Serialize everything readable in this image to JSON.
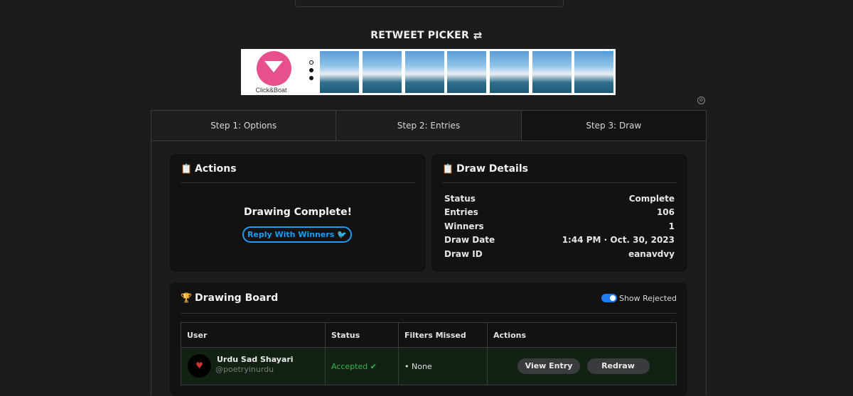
{
  "header": {
    "title": "RETWEET PICKER",
    "title_icon": "retweet-icon"
  },
  "ad": {
    "brand": "Click&Boat",
    "logo_icon": "paper-boat-icon",
    "choice_mark": "▷✕"
  },
  "tabs": [
    {
      "label": "Step 1: Options"
    },
    {
      "label": "Step 2: Entries"
    },
    {
      "label": "Step 3: Draw",
      "active": true
    }
  ],
  "actions": {
    "title": "Actions",
    "icon": "clipboard-check-icon",
    "status_heading": "Drawing Complete!",
    "reply_label": "Reply With Winners",
    "reply_icon": "twitter-icon"
  },
  "details": {
    "title": "Draw Details",
    "icon": "clipboard-list-icon",
    "rows": [
      {
        "label": "Status",
        "value": "Complete"
      },
      {
        "label": "Entries",
        "value": "106"
      },
      {
        "label": "Winners",
        "value": "1"
      },
      {
        "label": "Draw Date",
        "value": "1:44 PM · Oct. 30, 2023"
      },
      {
        "label": "Draw ID",
        "value": "eanavdvy"
      }
    ]
  },
  "board": {
    "title": "Drawing Board",
    "icon": "trophy-icon",
    "show_rejected_label": "Show Rejected",
    "show_rejected": true,
    "columns": [
      "User",
      "Status",
      "Filters Missed",
      "Actions"
    ],
    "rows": [
      {
        "name": "Urdu Sad Shayari",
        "handle": "@poetryinurdu",
        "status": "Accepted",
        "filters_missed": "• None",
        "view_label": "View Entry",
        "redraw_label": "Redraw"
      }
    ]
  },
  "colors": {
    "background": "#1c1c1d",
    "card": "#121212",
    "accent": "#1d9bf0",
    "accepted": "#2fb84c",
    "row_bg": "#122212"
  }
}
